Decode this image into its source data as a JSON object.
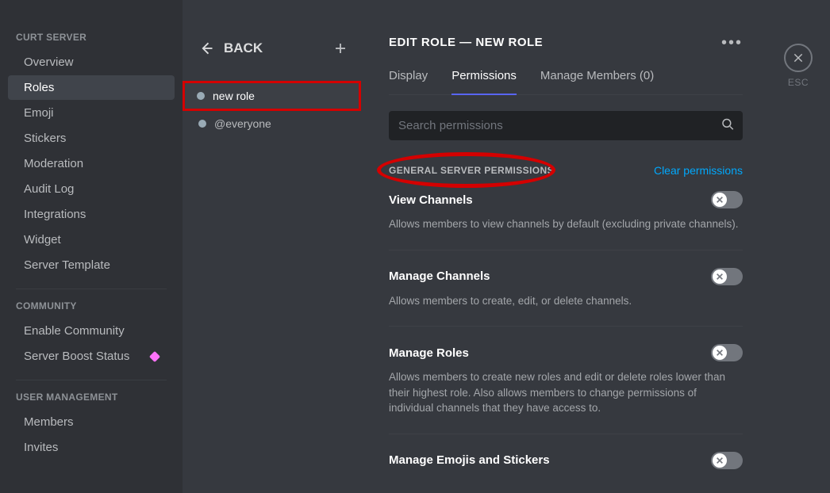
{
  "sidebar": {
    "groups": [
      {
        "header": "CURT SERVER",
        "items": [
          "Overview",
          "Roles",
          "Emoji",
          "Stickers",
          "Moderation",
          "Audit Log",
          "Integrations",
          "Widget",
          "Server Template"
        ],
        "selected": 1
      },
      {
        "header": "COMMUNITY",
        "items": [
          "Enable Community",
          "Server Boost Status"
        ],
        "selected": -1
      },
      {
        "header": "USER MANAGEMENT",
        "items": [
          "Members",
          "Invites"
        ],
        "selected": -1
      }
    ]
  },
  "rolesCol": {
    "back": "BACK",
    "roles": [
      {
        "name": "new role",
        "selected": true,
        "boxed": true,
        "dot": "#99aab5"
      },
      {
        "name": "@everyone",
        "selected": false,
        "boxed": false,
        "dot": "#99aab5"
      }
    ]
  },
  "main": {
    "title": "EDIT ROLE — NEW ROLE",
    "tabs": [
      "Display",
      "Permissions",
      "Manage Members (0)"
    ],
    "activeTab": 1,
    "searchPlaceholder": "Search permissions",
    "sectionHeader": "GENERAL SERVER PERMISSIONS",
    "clear": "Clear permissions",
    "perms": [
      {
        "name": "View Channels",
        "desc": "Allows members to view channels by default (excluding private channels).",
        "on": false
      },
      {
        "name": "Manage Channels",
        "desc": "Allows members to create, edit, or delete channels.",
        "on": false
      },
      {
        "name": "Manage Roles",
        "desc": "Allows members to create new roles and edit or delete roles lower than their highest role. Also allows members to change permissions of individual channels that they have access to.",
        "on": false
      },
      {
        "name": "Manage Emojis and Stickers",
        "desc": "",
        "on": false
      }
    ]
  },
  "close": {
    "label": "ESC"
  }
}
